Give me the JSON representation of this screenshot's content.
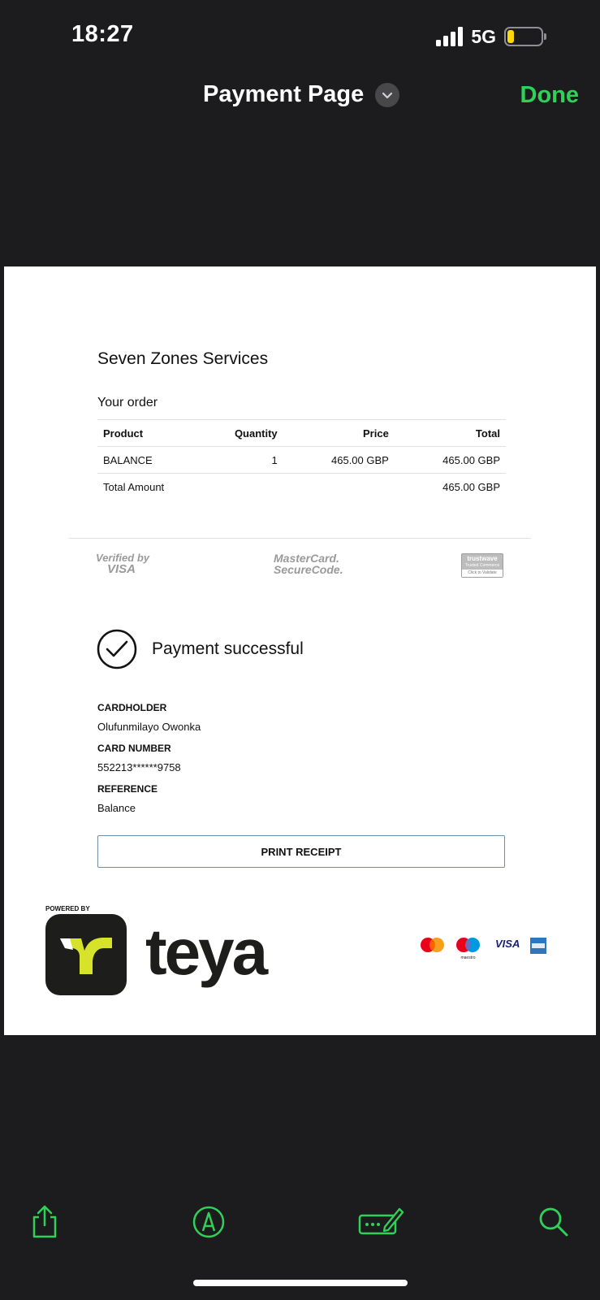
{
  "status_bar": {
    "time": "18:27",
    "network": "5G",
    "battery_level": 0.15
  },
  "nav": {
    "title": "Payment Page",
    "done_label": "Done"
  },
  "document": {
    "merchant": "Seven Zones Services",
    "your_order": "Your order",
    "table": {
      "headers": [
        "Product",
        "Quantity",
        "Price",
        "Total"
      ],
      "rows": [
        [
          "BALANCE",
          "1",
          "465.00 GBP",
          "465.00 GBP"
        ]
      ],
      "total_label": "Total Amount",
      "total_value": "465.00 GBP"
    },
    "security": {
      "verified_by": "Verified by",
      "visa": "VISA",
      "mastercard_1": "MasterCard.",
      "mastercard_2": "SecureCode.",
      "trustwave": "trustwave",
      "trustwave_sub": "Trusted Commerce",
      "trustwave_click": "Click to Validate"
    },
    "status": "Payment successful",
    "cardholder_label": "CARDHOLDER",
    "cardholder": "Olufunmilayo Owonka",
    "card_number_label": "CARD NUMBER",
    "card_number": "552213******9758",
    "reference_label": "REFERENCE",
    "reference": "Balance",
    "print_label": "PRINT RECEIPT",
    "powered_by": "POWERED BY",
    "brand": "teya",
    "card_logos": {
      "maestro": "maestro",
      "visa": "VISA"
    }
  },
  "colors": {
    "accent": "#30d158",
    "background": "#1c1c1e",
    "teya_lime": "#d6e32a",
    "paper": "#ffffff"
  },
  "toolbar": {
    "icons": [
      "share-icon",
      "markup-icon",
      "signature-icon",
      "search-icon"
    ]
  }
}
